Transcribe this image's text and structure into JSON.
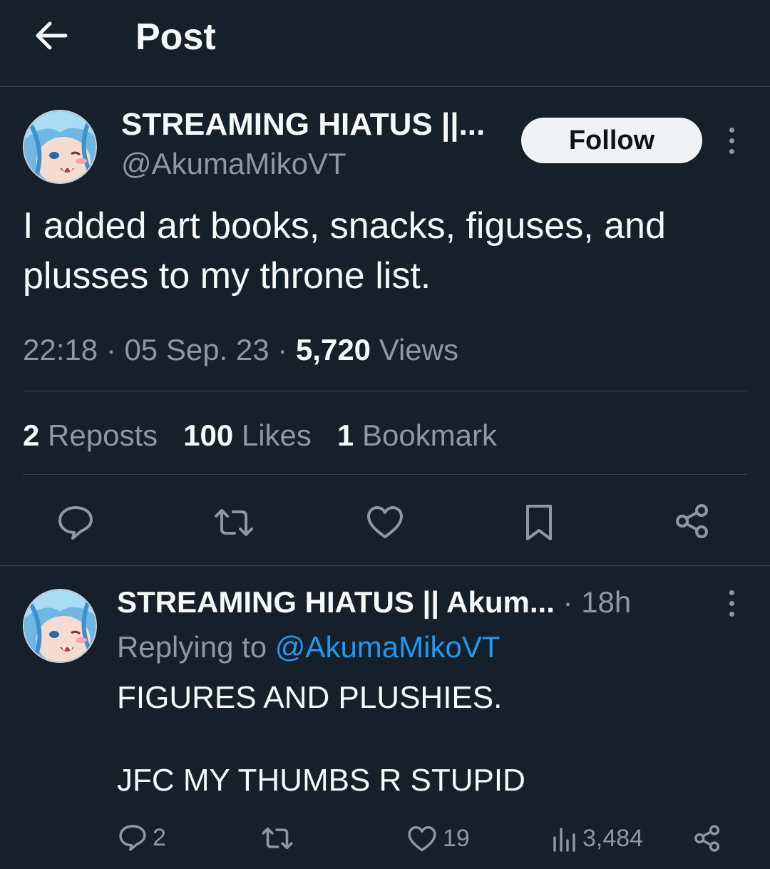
{
  "header": {
    "title": "Post"
  },
  "post": {
    "display_name": "STREAMING HIATUS ||...",
    "handle": "@AkumaMikoVT",
    "follow_label": "Follow",
    "text": "I added art books, snacks, figuses, and plusses to my throne list.",
    "time": "22:18",
    "date": "05 Sep. 23",
    "views_count": "5,720",
    "views_label": "Views",
    "reposts_count": "2",
    "reposts_label": "Reposts",
    "likes_count": "100",
    "likes_label": "Likes",
    "bookmarks_count": "1",
    "bookmarks_label": "Bookmark",
    "actions": [
      "reply-icon",
      "repost-icon",
      "like-icon",
      "bookmark-icon",
      "share-icon"
    ]
  },
  "reply": {
    "display_name": "STREAMING HIATUS || Akum...",
    "time_ago": "18h",
    "replying_prefix": "Replying to",
    "replying_handle": "@AkumaMikoVT",
    "lines": [
      "FIGURES AND PLUSHIES.",
      "",
      "JFC MY THUMBS R STUPID"
    ],
    "reply_count": "2",
    "likes_count": "19",
    "views_count": "3,484"
  },
  "colors": {
    "background": "#15202b",
    "text": "#f7f9f9",
    "muted": "#8b98a5",
    "divider": "#38444d",
    "link": "#1d9bf0",
    "follow_bg": "#eff3f4"
  }
}
